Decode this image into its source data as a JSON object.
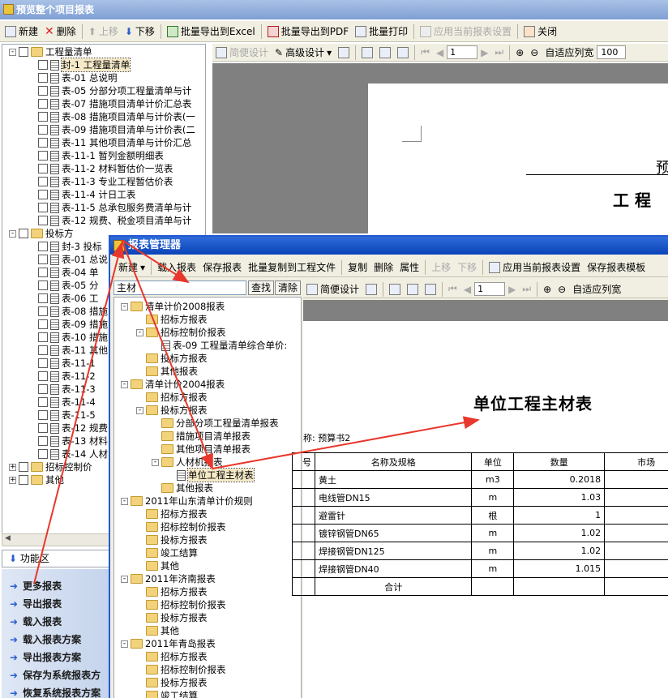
{
  "main_window": {
    "title": "预览整个项目报表"
  },
  "main_toolbar": [
    {
      "label": "新建",
      "icon": "new-icon",
      "enabled": true
    },
    {
      "label": "删除",
      "icon": "delete-icon",
      "enabled": true
    },
    {
      "label": "上移",
      "icon": "up-icon",
      "enabled": false
    },
    {
      "label": "下移",
      "icon": "down-icon",
      "enabled": true
    },
    {
      "label": "批量导出到Excel",
      "icon": "excel-icon",
      "enabled": true
    },
    {
      "label": "批量导出到PDF",
      "icon": "pdf-icon",
      "enabled": true
    },
    {
      "label": "批量打印",
      "icon": "print-icon",
      "enabled": true
    },
    {
      "label": "应用当前报表设置",
      "icon": "apply-icon",
      "enabled": false
    },
    {
      "label": "关闭",
      "icon": "close-icon",
      "enabled": true
    }
  ],
  "preview_toolbar": {
    "simple_design": "简便设计",
    "advanced_design": "高级设计",
    "page": "1",
    "fit": "自适应列宽",
    "zoom": "100"
  },
  "left_tree": {
    "group1": "工程量清单",
    "group1_items": [
      "封-1 工程量清单",
      "表-01 总说明",
      "表-05 分部分项工程量清单与计",
      "表-07 措施项目清单计价汇总表",
      "表-08 措施项目清单与计价表(一",
      "表-09 措施项目清单与计价表(二",
      "表-11 其他项目清单与计价汇总",
      "表-11-1 暂列金额明细表",
      "表-11-2 材料暂估价一览表",
      "表-11-3 专业工程暂估价表",
      "表-11-4 计日工表",
      "表-11-5 总承包服务费清单与计",
      "表-12 规费、税金项目清单与计"
    ],
    "group2": "投标方",
    "group2_items": [
      "封-3 投标",
      "表-01 总说",
      "表-04 单",
      "表-05 分",
      "表-06 工",
      "表-08 措施",
      "表-09 措施",
      "表-10 措施",
      "表-11 其他",
      "表-11-1",
      "表-11-2",
      "表-11-3",
      "表-11-4",
      "表-11-5",
      "表-12 规费",
      "表-13 材料",
      "表-14 人材"
    ],
    "group3": "招标控制价",
    "group4": "其他"
  },
  "func_area": {
    "title": "功能区",
    "items": [
      "更多报表",
      "导出报表",
      "载入报表",
      "载入报表方案",
      "导出报表方案",
      "保存为系统报表方",
      "恢复系统报表方案"
    ]
  },
  "page_preview": {
    "title_partial": "预",
    "heading_partial": "工 程"
  },
  "dialog": {
    "title": "报表管理器",
    "toolbar": [
      "新建",
      "载入报表",
      "保存报表",
      "批量复制到工程文件",
      "复制",
      "删除",
      "属性",
      "上移",
      "下移",
      "应用当前报表设置",
      "保存报表模板"
    ],
    "search_value": "主材",
    "search_button": "查找",
    "clear_button": "清除",
    "tree": [
      {
        "level": 0,
        "type": "folder",
        "label": "清单计价2008报表",
        "exp": "-"
      },
      {
        "level": 1,
        "type": "folder",
        "label": "招标方报表"
      },
      {
        "level": 1,
        "type": "folder",
        "label": "招标控制价报表",
        "exp": "-"
      },
      {
        "level": 2,
        "type": "doc",
        "label": "表-09 工程量清单综合单价:"
      },
      {
        "level": 1,
        "type": "folder",
        "label": "投标方报表"
      },
      {
        "level": 1,
        "type": "folder",
        "label": "其他报表"
      },
      {
        "level": 0,
        "type": "folder",
        "label": "清单计价2004报表",
        "exp": "-"
      },
      {
        "level": 1,
        "type": "folder",
        "label": "招标方报表"
      },
      {
        "level": 1,
        "type": "folder",
        "label": "投标方报表",
        "exp": "-"
      },
      {
        "level": 2,
        "type": "folder",
        "label": "分部分项工程量清单报表"
      },
      {
        "level": 2,
        "type": "folder",
        "label": "措施项目清单报表"
      },
      {
        "level": 2,
        "type": "folder",
        "label": "其他项目清单报表"
      },
      {
        "level": 2,
        "type": "folder",
        "label": "人材机报表",
        "exp": "-"
      },
      {
        "level": 3,
        "type": "doc",
        "label": "单位工程主材表",
        "selected": true
      },
      {
        "level": 2,
        "type": "folder",
        "label": "其他报表"
      },
      {
        "level": 0,
        "type": "folder",
        "label": "2011年山东清单计价规则",
        "exp": "-"
      },
      {
        "level": 1,
        "type": "folder",
        "label": "招标方报表"
      },
      {
        "level": 1,
        "type": "folder",
        "label": "招标控制价报表"
      },
      {
        "level": 1,
        "type": "folder",
        "label": "投标方报表"
      },
      {
        "level": 1,
        "type": "folder",
        "label": "竣工结算"
      },
      {
        "level": 1,
        "type": "folder",
        "label": "其他"
      },
      {
        "level": 0,
        "type": "folder",
        "label": "2011年济南报表",
        "exp": "-"
      },
      {
        "level": 1,
        "type": "folder",
        "label": "招标方报表"
      },
      {
        "level": 1,
        "type": "folder",
        "label": "招标控制价报表"
      },
      {
        "level": 1,
        "type": "folder",
        "label": "投标方报表"
      },
      {
        "level": 1,
        "type": "folder",
        "label": "其他"
      },
      {
        "level": 0,
        "type": "folder",
        "label": "2011年青岛报表",
        "exp": "-"
      },
      {
        "level": 1,
        "type": "folder",
        "label": "招标方报表"
      },
      {
        "level": 1,
        "type": "folder",
        "label": "招标控制价报表"
      },
      {
        "level": 1,
        "type": "folder",
        "label": "投标方报表"
      },
      {
        "level": 1,
        "type": "folder",
        "label": "竣工结算"
      }
    ],
    "preview_toolbar": {
      "simple_design": "简便设计",
      "page": "1",
      "fit": "自适应列宽"
    },
    "report": {
      "title": "单位工程主材表",
      "subtitle": "称: 预算书2",
      "headers": [
        "号",
        "名称及规格",
        "单位",
        "数量",
        "市场"
      ],
      "rows": [
        [
          "黄土",
          "m3",
          "0.2018"
        ],
        [
          "电线管DN15",
          "m",
          "1.03"
        ],
        [
          "避雷针",
          "根",
          "1"
        ],
        [
          "镀锌钢管DN65",
          "m",
          "1.02"
        ],
        [
          "焊接钢管DN125",
          "m",
          "1.02"
        ],
        [
          "焊接钢管DN40",
          "m",
          "1.015"
        ]
      ],
      "total": "合计"
    }
  }
}
